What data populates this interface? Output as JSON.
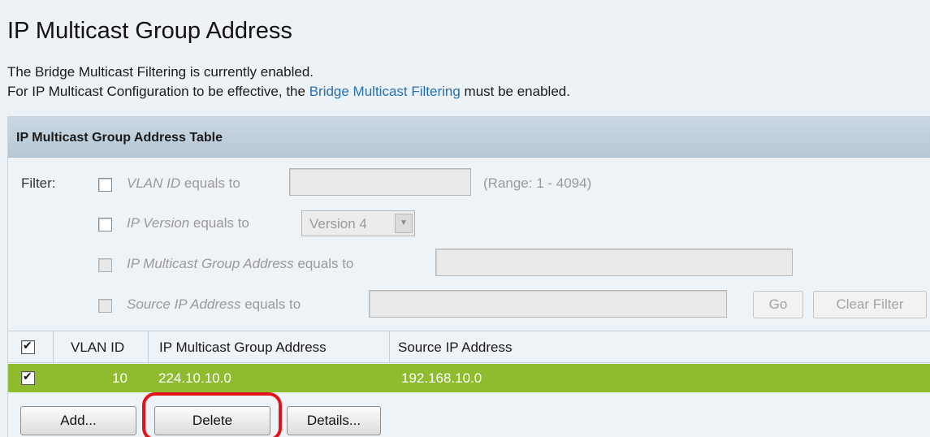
{
  "page": {
    "title": "IP Multicast Group Address",
    "status_line1": "The Bridge Multicast Filtering is currently enabled.",
    "status_line2_prefix": "For IP Multicast Configuration to be effective, the ",
    "status_line2_link": "Bridge Multicast Filtering",
    "status_line2_suffix": " must be enabled."
  },
  "table": {
    "header": "IP Multicast Group Address Table",
    "filter": {
      "label": "Filter:",
      "vlan": {
        "label_italic": "VLAN ID",
        "label_rest": " equals to",
        "value": "",
        "range_hint": "(Range: 1 - 4094)",
        "checked": false
      },
      "ip_version": {
        "label_italic": "IP Version",
        "label_rest": " equals to",
        "selected": "Version 4",
        "checked": false
      },
      "group_address": {
        "label_italic": "IP Multicast Group Address",
        "label_rest": " equals to",
        "value": "",
        "checked": false
      },
      "source_ip": {
        "label_italic": "Source IP Address",
        "label_rest": " equals to",
        "value": "",
        "checked": false
      },
      "go_button": "Go",
      "clear_button": "Clear Filter"
    },
    "columns": [
      "VLAN ID",
      "IP Multicast Group Address",
      "Source IP Address"
    ],
    "rows": [
      {
        "checked": true,
        "vlan_id": "10",
        "group_address": "224.10.10.0",
        "source_ip": "192.168.10.0"
      }
    ],
    "row_highlight_color": "#8fbb2f"
  },
  "actions": {
    "add": "Add...",
    "delete": "Delete",
    "details": "Details..."
  },
  "colors": {
    "link": "#2a6fb0",
    "highlight_ring": "#e3131b"
  }
}
